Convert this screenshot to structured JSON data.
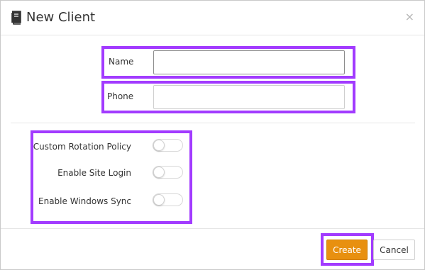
{
  "dialog": {
    "title": "New Client",
    "title_icon": "book-icon",
    "close_icon": "close-icon",
    "close_glyph": "×"
  },
  "form": {
    "name_label": "Name",
    "name_value": "",
    "phone_label": "Phone",
    "phone_value": ""
  },
  "toggles": [
    {
      "label": "Custom Rotation Policy",
      "on": false
    },
    {
      "label": "Enable Site Login",
      "on": false
    },
    {
      "label": "Enable Windows Sync",
      "on": false
    }
  ],
  "footer": {
    "create_label": "Create",
    "cancel_label": "Cancel"
  },
  "colors": {
    "highlight": "#a23bff",
    "primary_button": "#e8900f"
  }
}
